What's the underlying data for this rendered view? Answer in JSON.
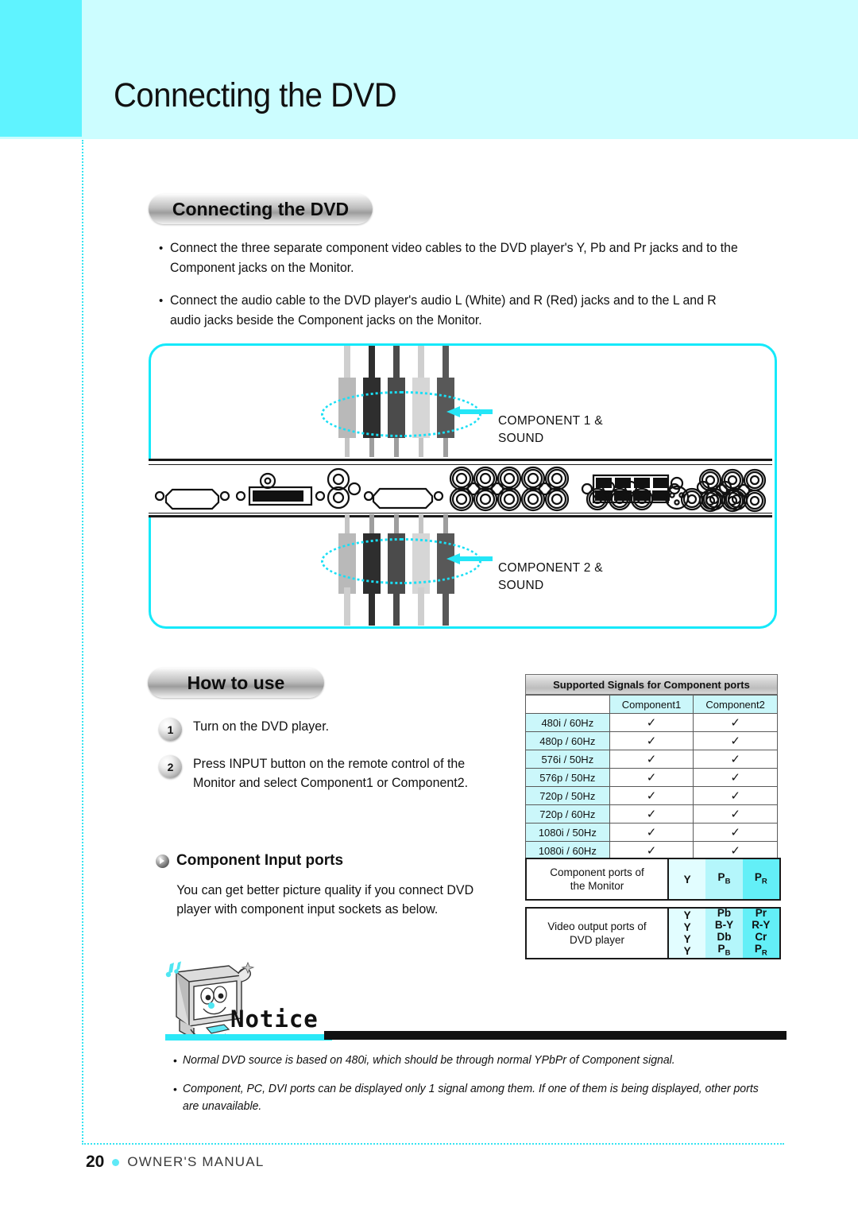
{
  "header": {
    "title": "Connecting the DVD"
  },
  "section": {
    "pill_connecting": "Connecting the DVD",
    "pill_howtouse": "How to use",
    "bullet_char": "•"
  },
  "intro_bullets": [
    "Connect the three separate component video cables to the DVD player's Y, Pb and Pr jacks and to the Component jacks on the Monitor.",
    "Connect the audio cable to the DVD player's audio L (White) and R (Red) jacks and to the L and R audio jacks beside the Component jacks on the Monitor."
  ],
  "diagram": {
    "callout_top": "COMPONENT 1 &\nSOUND",
    "callout_top_line1": "COMPONENT 1 &",
    "callout_top_line2": "SOUND",
    "callout_bottom_line1": "COMPONENT 2 &",
    "callout_bottom_line2": "SOUND",
    "plug_colors": [
      "#b9b9b9",
      "#2e2e2e",
      "#4b4b4b",
      "#d6d6d6",
      "#585858"
    ],
    "accent_cyan": "#15E9FA"
  },
  "steps": [
    {
      "num": "1",
      "text": "Turn on the DVD player."
    },
    {
      "num": "2",
      "text": "Press INPUT button on the remote control of the Monitor and select Component1 or Component2."
    }
  ],
  "component_input": {
    "title": "Component Input ports",
    "body": "You can get better picture quality if you connect DVD player with component input sockets as below."
  },
  "signal_table": {
    "caption": "Supported Signals for Component ports",
    "columns": [
      "",
      "Component1",
      "Component2"
    ],
    "check_mark": "ⅴ",
    "rows": [
      {
        "label": "480i / 60Hz",
        "component1": "✓",
        "component2": "✓"
      },
      {
        "label": "480p / 60Hz",
        "component1": "✓",
        "component2": "✓"
      },
      {
        "label": "576i / 50Hz",
        "component1": "✓",
        "component2": "✓"
      },
      {
        "label": "576p / 50Hz",
        "component1": "✓",
        "component2": "✓"
      },
      {
        "label": "720p / 50Hz",
        "component1": "✓",
        "component2": "✓"
      },
      {
        "label": "720p / 60Hz",
        "component1": "✓",
        "component2": "✓"
      },
      {
        "label": "1080i / 50Hz",
        "component1": "✓",
        "component2": "✓"
      },
      {
        "label": "1080i / 60Hz",
        "component1": "✓",
        "component2": "✓"
      }
    ]
  },
  "port_map": {
    "monitor_row": {
      "name_line1": "Component ports of",
      "name_line2": "the Monitor",
      "y": "Y",
      "pb_main": "P",
      "pb_sub": "B",
      "pr_main": "P",
      "pr_sub": "R"
    },
    "dvd_row": {
      "name_line1": "Video output ports of",
      "name_line2": "DVD player",
      "col_y": [
        "Y",
        "Y",
        "Y",
        "Y"
      ],
      "col_pb": [
        "Pb",
        "B-Y",
        "Db",
        "PB"
      ],
      "col_pr": [
        "Pr",
        "R-Y",
        "Cr",
        "PR"
      ],
      "col_pb_last_main": "P",
      "col_pb_last_sub": "B",
      "col_pr_last_main": "P",
      "col_pr_last_sub": "R"
    },
    "shade1": "#E2FDFF",
    "shade2": "#B4F6FB",
    "shade3": "#63EFF7"
  },
  "notice": {
    "word": "Notice",
    "items": [
      "Normal DVD source is based on 480i, which should be through normal YPbPr of Component signal.",
      "Component, PC, DVI ports can be displayed only 1 signal among them. If one of them is being displayed, other ports are unavailable."
    ]
  },
  "footer": {
    "page": "20",
    "label": "OWNER'S MANUAL"
  }
}
